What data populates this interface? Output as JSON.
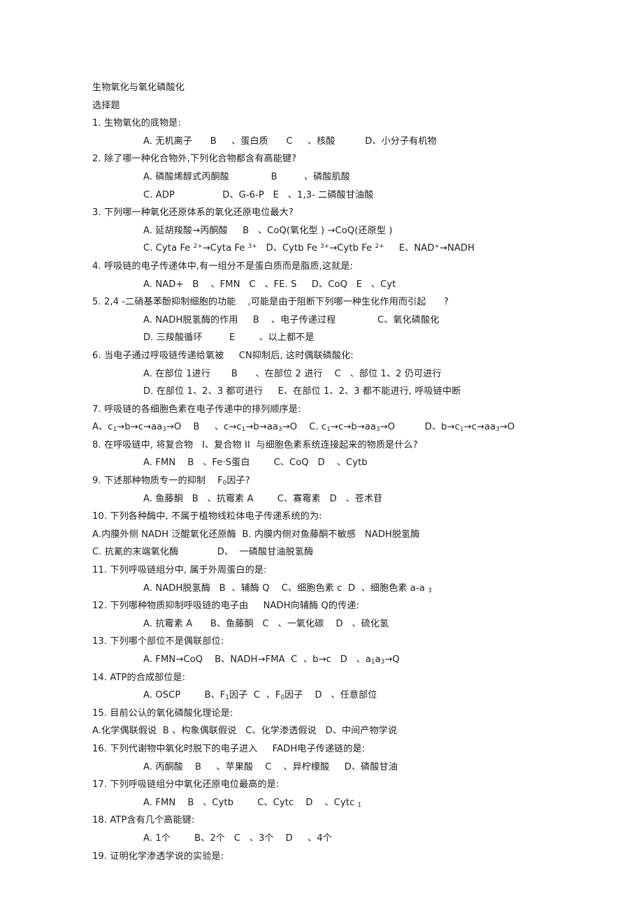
{
  "document": {
    "title": "生物氧化与氧化磷酸化",
    "section_heading": "选择题",
    "lines": [
      {
        "id": "title",
        "kind": "title",
        "text": "生物氧化与氧化磷酸化"
      },
      {
        "id": "section",
        "kind": "heading",
        "text": "选择题"
      },
      {
        "id": "q1-stem",
        "kind": "stem",
        "text": "1. 生物氧化的底物是:"
      },
      {
        "id": "q1-a",
        "kind": "opts-indent",
        "text": "A. 无机离子      B     、蛋白质      C     、核酸          D、小分子有机物"
      },
      {
        "id": "q2-stem",
        "kind": "stem",
        "text": "2. 除了哪一种化合物外,下列化合物都含有高能键?"
      },
      {
        "id": "q2-a",
        "kind": "opts-indent",
        "text": "A. 磷酸烯醇式丙酮酸              B         、磷酸肌酸"
      },
      {
        "id": "q2-b",
        "kind": "opts-indent",
        "text": "C. ADP                D、G-6-P   E   、1,3- 二磷酸甘油酸"
      },
      {
        "id": "q3-stem",
        "kind": "stem",
        "text": "3. 下列哪一种氧化还原体系的氧化还原电位最大?"
      },
      {
        "id": "q3-a",
        "kind": "opts-indent",
        "text": "A. 延胡羧酸→丙酮酸     B   、CoQ(氧化型 ) →CoQ(还原型 )"
      },
      {
        "id": "q3-b",
        "kind": "opts-indent",
        "html": "C. Cyta Fe <sup>2+</sup>→Cyta Fe <sup>3+</sup>   D、Cytb Fe <sup>3+</sup>→Cytb Fe <sup>2+</sup>     E、NAD<sup>+</sup>→NADH"
      },
      {
        "id": "q4-stem",
        "kind": "stem",
        "text": "4. 呼吸链的电子传递体中,有一组分不是蛋白质而是脂质,这就是:"
      },
      {
        "id": "q4-a",
        "kind": "opts-indent",
        "text": "A. NAD+   B    、FMN   C   、FE. S     D、CoQ   E   、Cyt"
      },
      {
        "id": "q5-stem",
        "kind": "stem",
        "text": "5. 2,4 -二硝基苯酚抑制细胞的功能    ,可能是由于阻断下列哪一种生化作用而引起      ?"
      },
      {
        "id": "q5-a",
        "kind": "opts-indent",
        "text": "A. NADH脱氢酶的作用     B    、电子传递过程              C、氧化磷酸化"
      },
      {
        "id": "q5-b",
        "kind": "opts-indent",
        "text": "D. 三羧酸循环         E        、以上都不是"
      },
      {
        "id": "q6-stem",
        "kind": "stem",
        "text": "6. 当电子通过呼吸链传递给氧被     CN抑制后, 这时偶联磷酸化:"
      },
      {
        "id": "q6-a",
        "kind": "opts-indent",
        "text": "A. 在部位 1进行       B      、在部位 2 进行    C   、部位 1、2 仍可进行"
      },
      {
        "id": "q6-b",
        "kind": "opts-indent",
        "text": "D. 在部位 1、2、3 都可进行     E、在部位 1、2、3 都不能进行, 呼吸链中断"
      },
      {
        "id": "q7-stem",
        "kind": "stem",
        "text": "7. 呼吸链的各细胞色素在电子传递中的排列顺序是:"
      },
      {
        "id": "q7-a",
        "kind": "opts-flush",
        "html": "A、c<sub>1</sub>→b→c→aa<sub>3</sub>→O    B     、c→c<sub>1</sub>→b→aa<sub>3</sub>→O    C. c<sub>1</sub>→c→b→aa<sub>3</sub>→O          D、b→c<sub>1</sub>→c→aa<sub>3</sub>→O"
      },
      {
        "id": "q8-stem",
        "kind": "stem",
        "text": "8. 在呼吸链中, 将复合物   I、复合物 II  与细胞色素系统连接起来的物质是什么?"
      },
      {
        "id": "q8-a",
        "kind": "opts-indent",
        "text": "A. FMN    B   、Fe·S蛋白        C、CoQ   D    、Cytb"
      },
      {
        "id": "q9-stem",
        "kind": "stem",
        "html": "9. 下述那种物质专一的抑制    F<sub>0</sub>因子?"
      },
      {
        "id": "q9-a",
        "kind": "opts-indent",
        "text": "A. 鱼藤酮   B   、抗霉素 A        C、寡霉素   D   、苍术苷"
      },
      {
        "id": "q10-stem",
        "kind": "stem",
        "text": "10. 下列各种酶中, 不属于植物线粒体电子传递系统的为:"
      },
      {
        "id": "q10-a",
        "kind": "opts-flush",
        "text": "A.内膜外侧 NADH 泛醌氧化还原酶  B. 内膜内侧对鱼藤酮不敏感   NADH脱氢酶"
      },
      {
        "id": "q10-b",
        "kind": "opts-flush",
        "text": "C. 抗氰的末端氧化酶             D、  一磷酸甘油脱氢酶"
      },
      {
        "id": "q11-stem",
        "kind": "stem",
        "text": "11. 下列呼吸链组分中, 属于外周蛋白的是:"
      },
      {
        "id": "q11-a",
        "kind": "opts-indent",
        "html": "A. NADH脱氢酶   B  、辅酶 Q    C、细胞色素 c  D  、细胞色素 a-a <sub>3</sub>"
      },
      {
        "id": "q12-stem",
        "kind": "stem",
        "text": "12. 下列哪种物质抑制呼吸链的电子由     NADH向辅酶 Q的传递:"
      },
      {
        "id": "q12-a",
        "kind": "opts-indent",
        "text": "A. 抗霉素 A      B、鱼藤酮   C   、一氧化碳    D   、硫化氢"
      },
      {
        "id": "q13-stem",
        "kind": "stem",
        "text": "13. 下列哪个部位不是偶联部位:"
      },
      {
        "id": "q13-a",
        "kind": "opts-indent",
        "html": "A. FMN→CoQ    B、NADH→FMA  C  、b→c   D   、a<sub>1</sub>a<sub>3</sub>→Q"
      },
      {
        "id": "q14-stem",
        "kind": "stem",
        "text": "14. ATP的合成部位是:"
      },
      {
        "id": "q14-a",
        "kind": "opts-indent",
        "html": "A. OSCP        B、F<sub>1</sub>因子  C  、F<sub>0</sub>因子    D   、任意部位"
      },
      {
        "id": "q15-stem",
        "kind": "stem",
        "text": "15. 目前公认的氧化磷酸化理论是:"
      },
      {
        "id": "q15-a",
        "kind": "opts-flush",
        "text": "A.化学偶联假说  B 、构象偶联假说   C、化学渗透假说   D、中间产物学说"
      },
      {
        "id": "q16-stem",
        "kind": "stem",
        "text": "16. 下列代谢物中氧化时脱下的电子进入     FADH电子传递链的是:"
      },
      {
        "id": "q16-a",
        "kind": "opts-indent",
        "text": "A. 丙酮酸    B     、苹果酸    C    、异柠檬酸     D、磷酸甘油"
      },
      {
        "id": "q17-stem",
        "kind": "stem",
        "text": "17. 下列呼吸链组分中氧化还原电位最高的是:"
      },
      {
        "id": "q17-a",
        "kind": "opts-indent",
        "html": "A. FMN    B   、Cytb        C、Cytc    D    、Cytc <sub>1</sub>"
      },
      {
        "id": "q18-stem",
        "kind": "stem",
        "text": "18. ATP含有几个高能键:"
      },
      {
        "id": "q18-a",
        "kind": "opts-indent",
        "text": "A. 1个        B、2个   C   、3个    D     、4个"
      },
      {
        "id": "q19-stem",
        "kind": "stem",
        "text": "19. 证明化学渗透学说的实验是:"
      }
    ]
  }
}
